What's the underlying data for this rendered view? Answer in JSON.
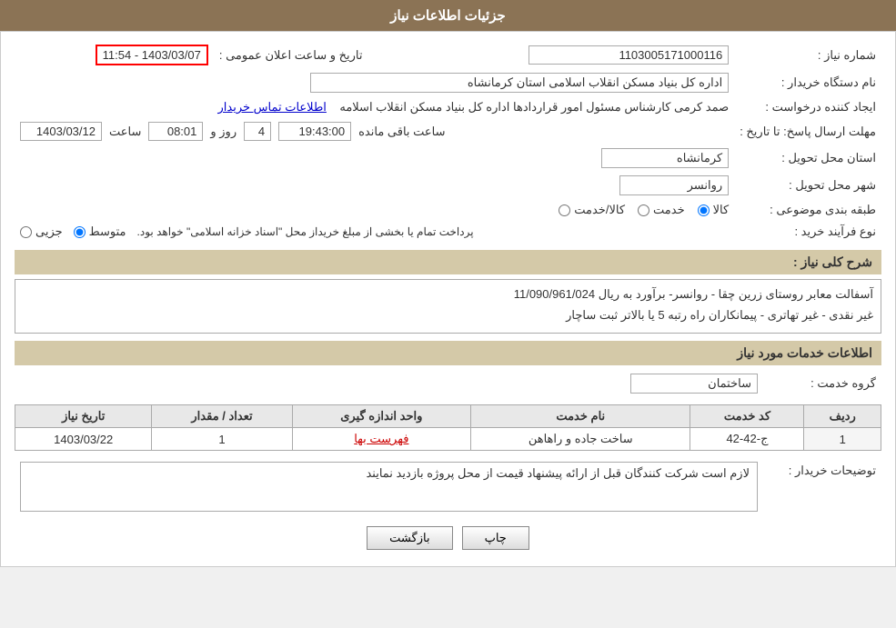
{
  "header": {
    "title": "جزئیات اطلاعات نیاز"
  },
  "fields": {
    "shomara_niaz_label": "شماره نیاز :",
    "shomara_niaz_value": "1103005171000116",
    "namdastgah_label": "نام دستگاه خریدار :",
    "namdastgah_value": "اداره کل بنیاد مسکن انقلاب اسلامی استان کرمانشاه",
    "ijad_konande_label": "ایجاد کننده درخواست :",
    "ijad_konande_value": "صمد کرمی کارشناس مسئول امور قراردادها اداره کل بنیاد مسکن انقلاب اسلامه",
    "ettelaat_link": "اطلاعات تماس خریدار",
    "mohlat_label": "مهلت ارسال پاسخ: تا تاریخ :",
    "tarikh_value": "1403/03/12",
    "saat_label": "ساعت",
    "saat_value": "08:01",
    "rooz_label": "روز و",
    "rooz_value": "4",
    "saat_manandeh_value": "19:43:00",
    "saat_manandeh_label": "ساعت باقی مانده",
    "tarikh_aalan_label": "تاریخ و ساعت اعلان عمومی :",
    "tarikh_aalan_value": "1403/03/07 - 11:54",
    "ostan_label": "استان محل تحویل :",
    "ostan_value": "کرمانشاه",
    "shahr_label": "شهر محل تحویل :",
    "shahr_value": "روانسر",
    "tabaqe_label": "طبقه بندی موضوعی :",
    "tabaqe_kala": "کالا",
    "tabaqe_khedmat": "خدمت",
    "tabaqe_kala_khedmat": "کالا/خدمت",
    "tabaqe_selected": "kala",
    "nooe_farayand_label": "نوع فرآیند خرید :",
    "nooe_jozii": "جزیی",
    "nooe_motevaset": "متوسط",
    "nooe_selected": "motevaset",
    "nooe_description": "پرداخت تمام یا بخشی از مبلغ خریداز محل \"اسناد خزانه اسلامی\" خواهد بود.",
    "sharh_label": "شرح کلی نیاز :",
    "sharh_value1": "آسفالت معابر روستای زرین چقا - روانسر- برآورد به ریال  11/090/961/024",
    "sharh_value2": "غیر نقدی - غیر تهاتری - پیمانکاران راه رتبه 5 یا بالاتر ثبت ساچار",
    "khedamat_label": "اطلاعات خدمات مورد نیاز",
    "grooh_khedmat_label": "گروه خدمت :",
    "grooh_khedmat_value": "ساختمان",
    "table_headers": {
      "radif": "ردیف",
      "kod_khedmat": "کد خدمت",
      "name_khedmat": "نام خدمت",
      "vahed": "واحد اندازه گیری",
      "tedad": "تعداد / مقدار",
      "tarikh_niaz": "تاریخ نیاز"
    },
    "table_rows": [
      {
        "radif": "1",
        "kod": "ج-42-42",
        "name": "ساخت جاده و راهاهن",
        "vahed": "فهرست بها",
        "tedad": "1",
        "tarikh": "1403/03/22"
      }
    ],
    "toseeh_label": "توضیحات خریدار :",
    "toseeh_value": "لازم است شرکت کنندگان قبل از ارائه پیشنهاد قیمت از محل پروژه بازدید نمایند",
    "btn_print": "چاپ",
    "btn_back": "بازگشت"
  }
}
